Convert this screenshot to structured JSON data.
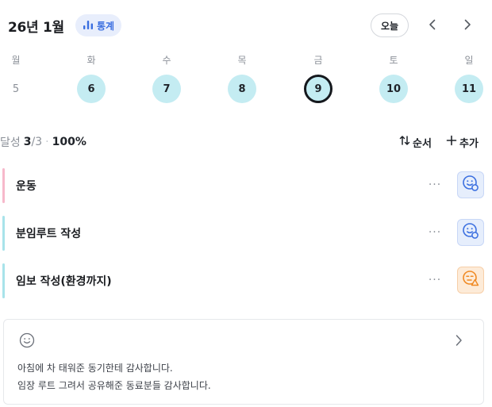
{
  "header": {
    "month_title": "26년 1월",
    "stats_label": "통계",
    "today_label": "오늘"
  },
  "week": {
    "weekdays": [
      "월",
      "화",
      "수",
      "목",
      "금",
      "토",
      "일"
    ],
    "dates": [
      {
        "day": "5",
        "state": "plain"
      },
      {
        "day": "6",
        "state": "done"
      },
      {
        "day": "7",
        "state": "done"
      },
      {
        "day": "8",
        "state": "done"
      },
      {
        "day": "9",
        "state": "selected"
      },
      {
        "day": "10",
        "state": "done"
      },
      {
        "day": "11",
        "state": "done"
      }
    ]
  },
  "summary": {
    "label": "달성",
    "completed": "3",
    "total": "/3",
    "separator": "·",
    "percent": "100%"
  },
  "actions": {
    "sort_label": "순서",
    "add_label": "추가"
  },
  "tasks": [
    {
      "title": "운동",
      "bar_color": "#f7b9cb",
      "mood": "blue",
      "more": "···"
    },
    {
      "title": "분임루트 작성",
      "bar_color": "#a8e3ea",
      "mood": "blue",
      "more": "···"
    },
    {
      "title": "임보 작성(환경까지)",
      "bar_color": "#a8e3ea",
      "mood": "orange",
      "more": "···"
    }
  ],
  "note": {
    "line1": "아침에 차 태워준 동기한테 감사합니다.",
    "line2": "임장 루트 그려서 공유해준 동료분들 감사합니다."
  },
  "colors": {
    "accent_blue": "#3b6fe0",
    "done_cyan": "#c4ecf2",
    "mood_orange": "#f08a24"
  }
}
